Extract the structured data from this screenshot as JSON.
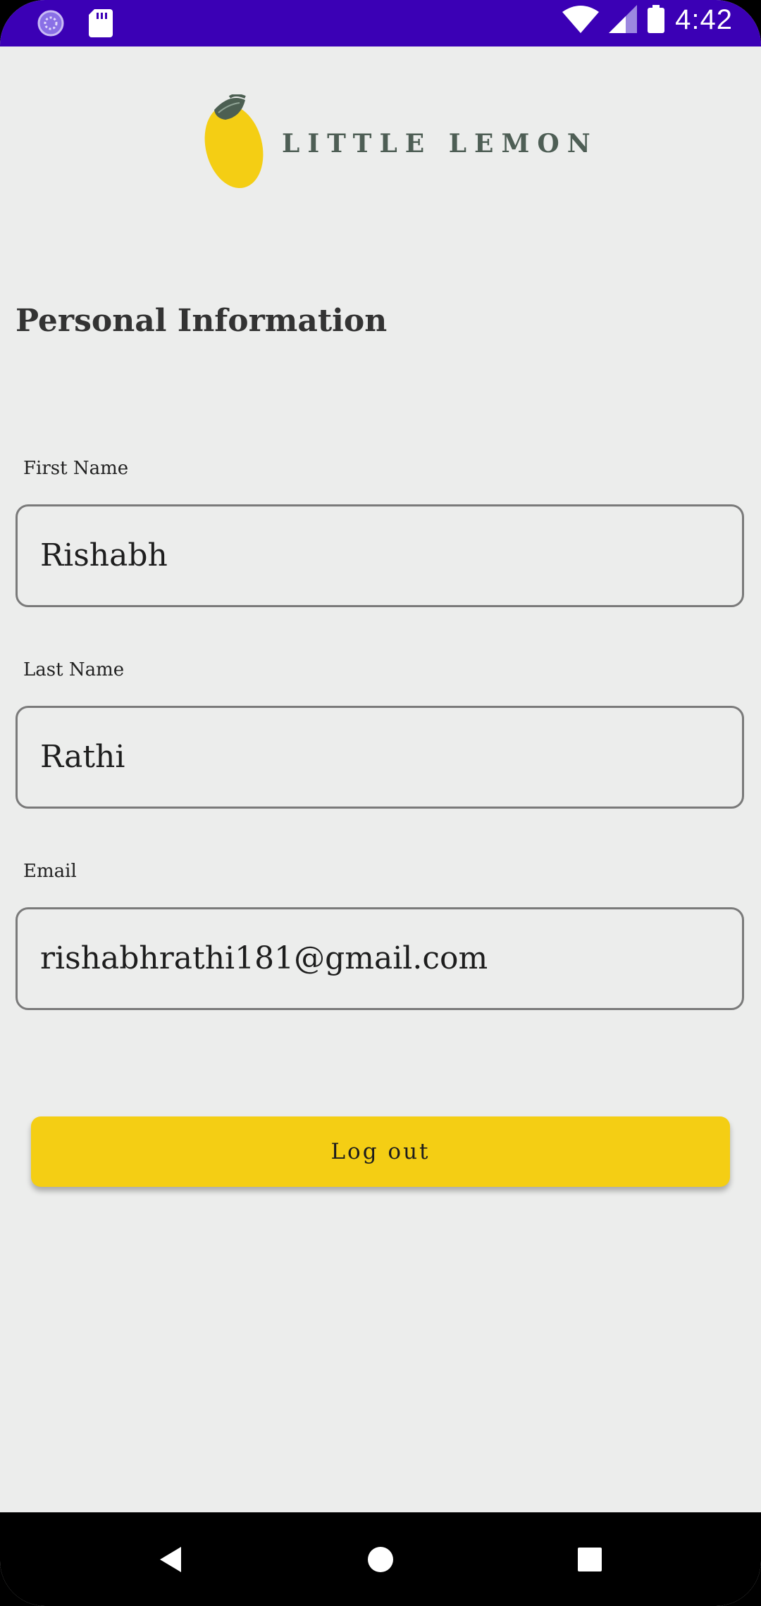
{
  "status_bar": {
    "time": "4:42",
    "icons": [
      "app-status-icon",
      "sd-card-icon",
      "wifi-icon",
      "cell-signal-icon",
      "battery-icon"
    ]
  },
  "logo": {
    "text": "LITTLE LEMON",
    "icon": "lemon-icon"
  },
  "page": {
    "title": "Personal Information"
  },
  "form": {
    "first_name": {
      "label": "First Name",
      "value": "Rishabh"
    },
    "last_name": {
      "label": "Last Name",
      "value": "Rathi"
    },
    "email": {
      "label": "Email",
      "value": "rishabhrathi181@gmail.com"
    }
  },
  "actions": {
    "logout_label": "Log out"
  },
  "nav_bar": {
    "icons": [
      "back-icon",
      "home-icon",
      "recents-icon"
    ]
  },
  "colors": {
    "status_bar": "#3B00B5",
    "background": "#ECEDEC",
    "accent_yellow": "#F4CE14",
    "logo_green": "#4E5E55"
  }
}
